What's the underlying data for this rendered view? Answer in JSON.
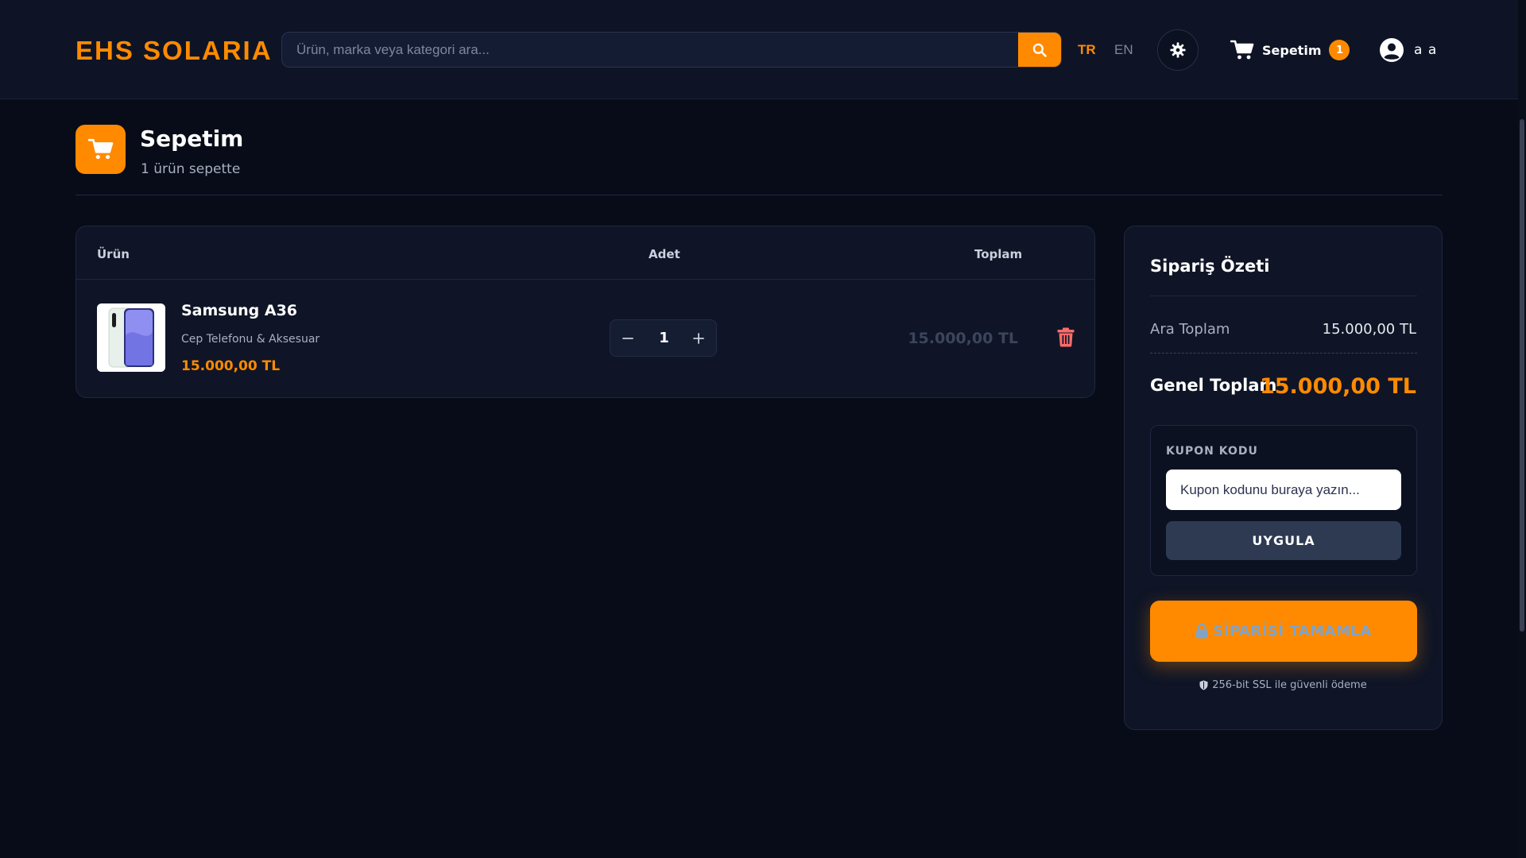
{
  "header": {
    "logo": "EHS SOLARIA",
    "search_placeholder": "Ürün, marka veya kategori ara...",
    "lang_tr": "TR",
    "lang_en": "EN",
    "cart_label": "Sepetim",
    "cart_count": "1",
    "user_name": "a a"
  },
  "page": {
    "title": "Sepetim",
    "subtitle": "1 ürün sepette"
  },
  "cart_table": {
    "headers": {
      "product": "Ürün",
      "qty": "Adet",
      "total": "Toplam"
    },
    "items": [
      {
        "name": "Samsung A36",
        "category": "Cep Telefonu & Aksesuar",
        "price": "15.000,00 TL",
        "quantity": "1",
        "total": "15.000,00 TL"
      }
    ]
  },
  "summary": {
    "title": "Sipariş Özeti",
    "subtotal_label": "Ara Toplam",
    "subtotal_value": "15.000,00 TL",
    "grand_label": "Genel Toplam",
    "grand_value": "15.000,00 TL",
    "coupon_label": "KUPON KODU",
    "coupon_placeholder": "Kupon kodunu buraya yazın...",
    "coupon_button": "UYGULA",
    "checkout_button": "SİPARİŞİ TAMAMLA",
    "ssl_note": "256-bit SSL ile güvenli ödeme"
  },
  "colors": {
    "accent": "#ff8a00",
    "background": "#080c18",
    "card": "#0f1526",
    "delete": "#ff6b6b"
  },
  "icons": [
    "search-icon",
    "gear-icon",
    "cart-icon",
    "user-icon",
    "trash-icon",
    "lock-icon",
    "shield-icon"
  ]
}
